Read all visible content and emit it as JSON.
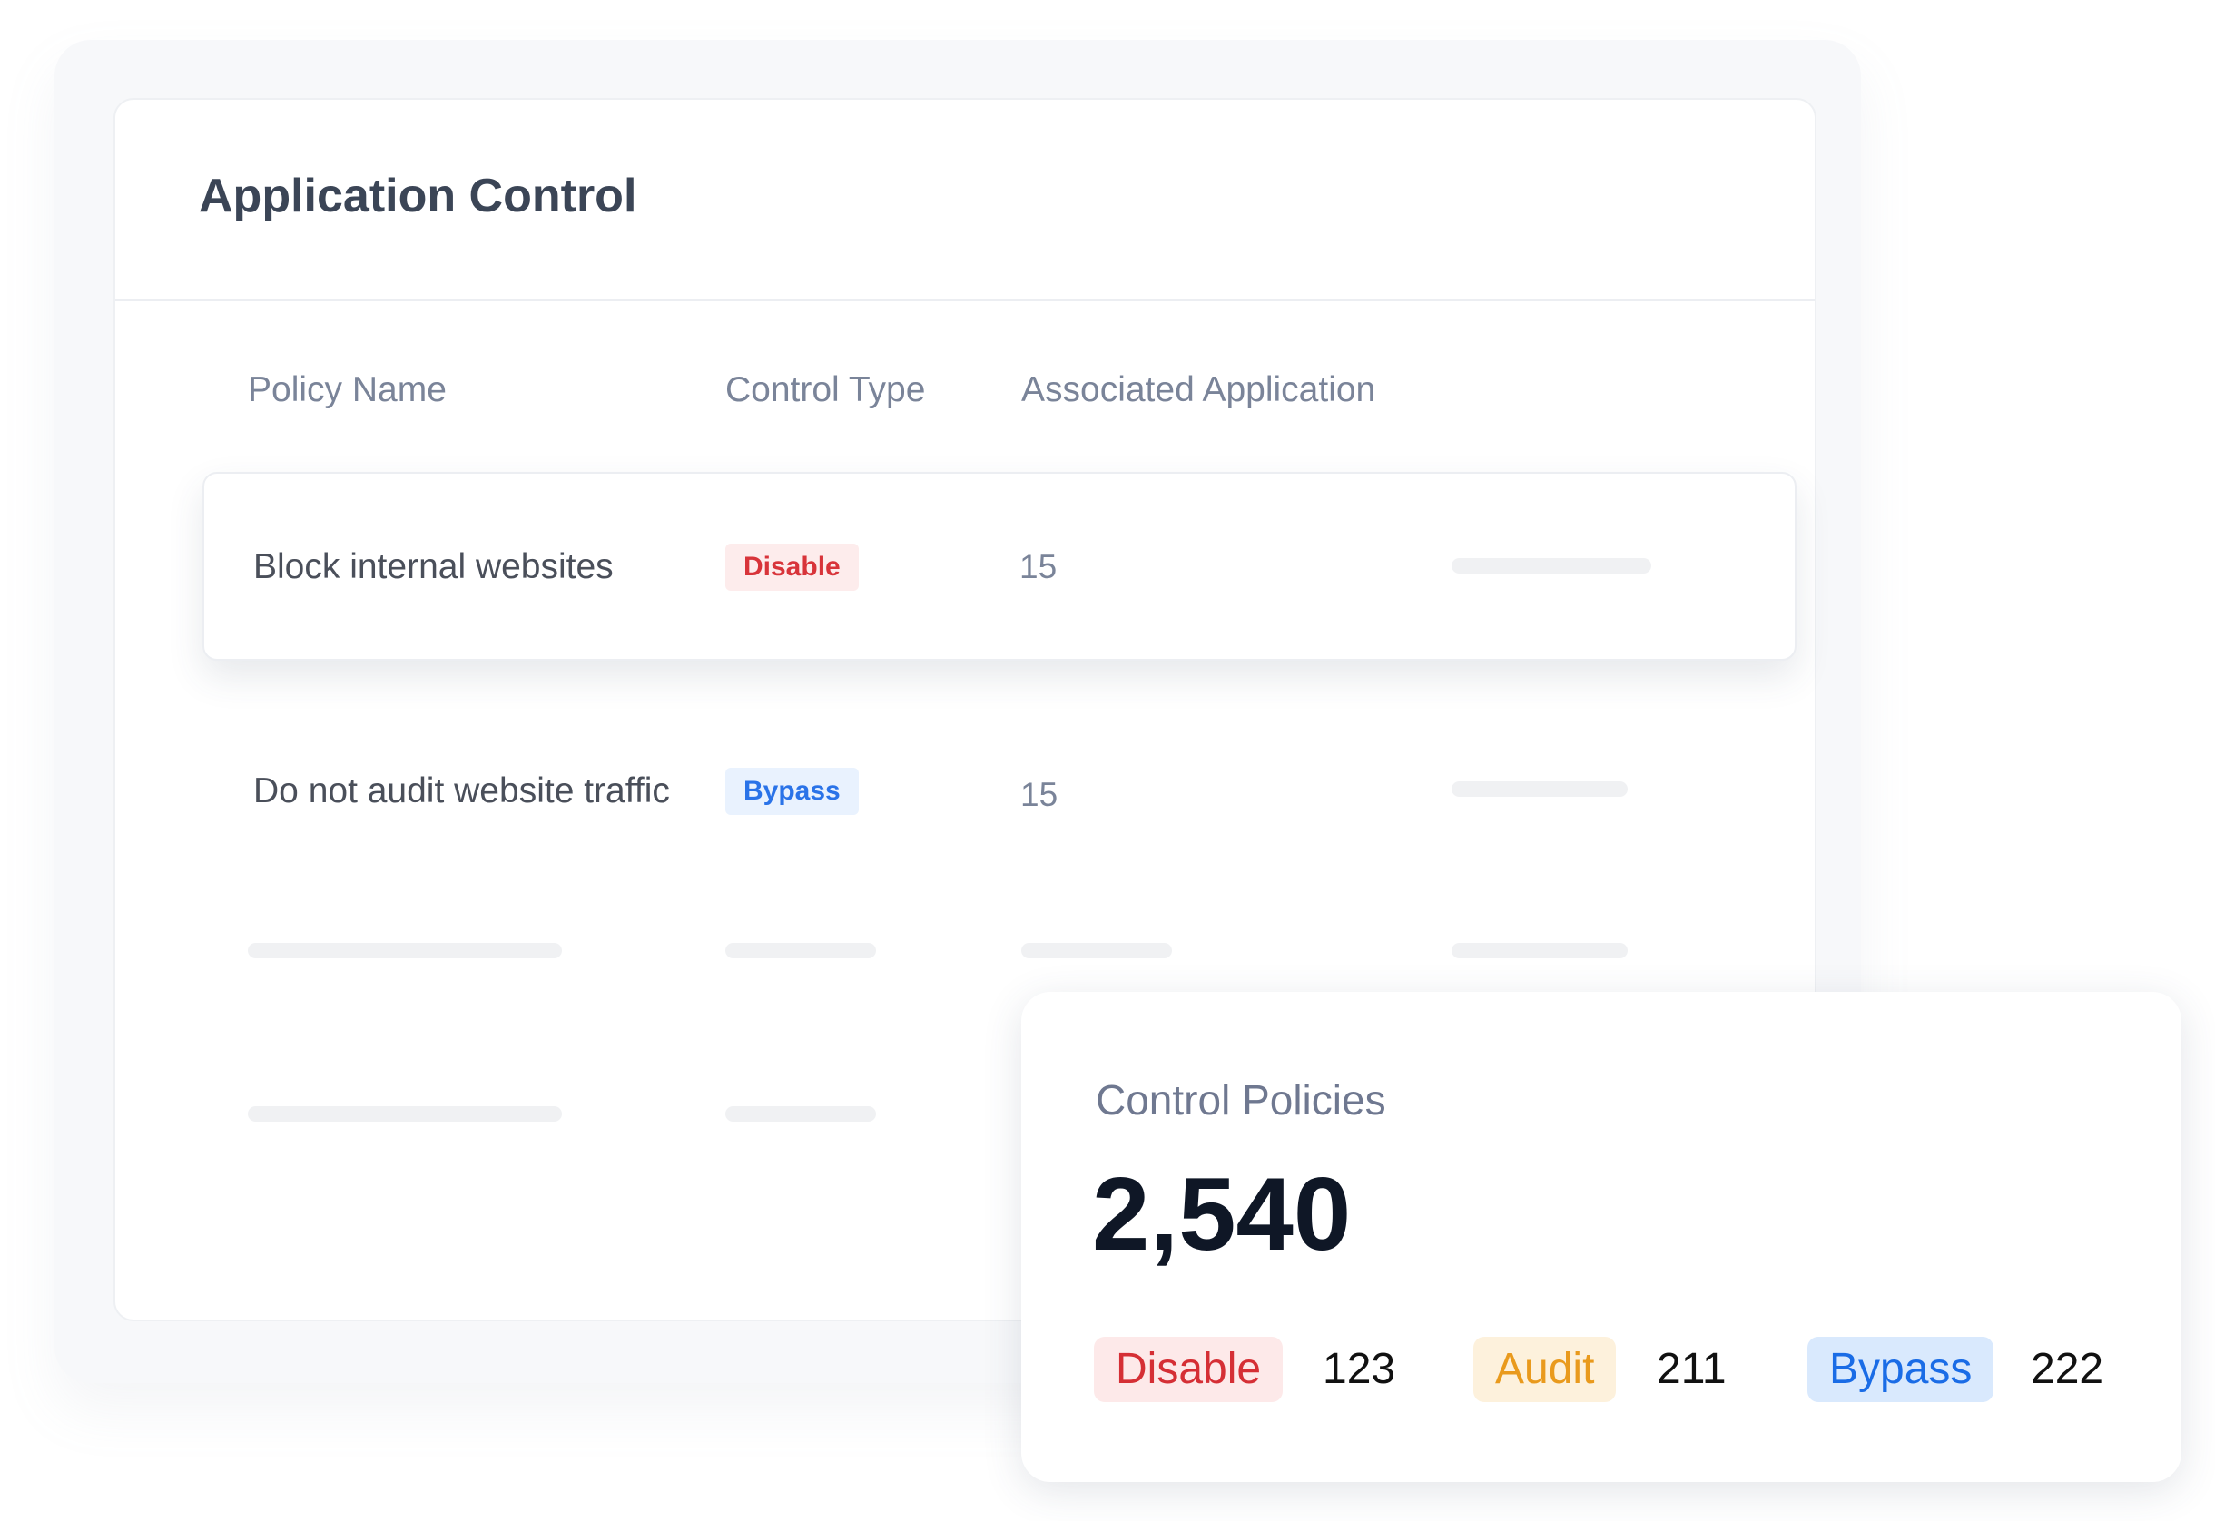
{
  "card": {
    "title": "Application Control"
  },
  "table": {
    "columns": [
      "Policy Name",
      "Control Type",
      "Associated Application"
    ],
    "rows": [
      {
        "policy_name": "Block internal websites",
        "control_type": "Disable",
        "associated_applications": "15"
      },
      {
        "policy_name": "Do not audit website traffic",
        "control_type": "Bypass",
        "associated_applications": "15"
      }
    ]
  },
  "stats": {
    "title": "Control Policies",
    "total": "2,540",
    "breakdown": [
      {
        "label": "Disable",
        "count": "123"
      },
      {
        "label": "Audit",
        "count": "211"
      },
      {
        "label": "Bypass",
        "count": "222"
      }
    ]
  },
  "colors": {
    "disable": "#d8343a",
    "audit": "#e99a1d",
    "bypass": "#2a73e8",
    "title": "#3b4556",
    "muted": "#7a8499"
  }
}
